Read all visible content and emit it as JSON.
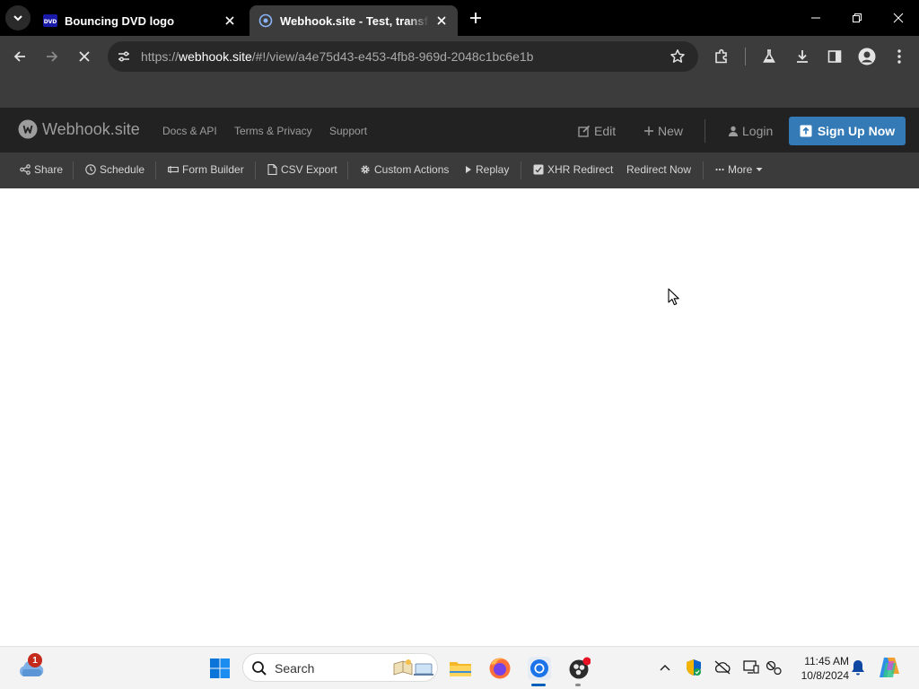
{
  "browser": {
    "tabs": [
      {
        "title": "Bouncing DVD logo",
        "active": false,
        "favicon": "dvd-icon"
      },
      {
        "title": "Webhook.site - Test, transform",
        "active": true,
        "favicon": "webhook-icon"
      }
    ],
    "url": {
      "prefix": "https://",
      "domain": "webhook.site",
      "path": "/#!/view/a4e75d43-e453-4fb8-969d-2048c1bc6e1b"
    },
    "loading": true
  },
  "site": {
    "brand": "Webhook.site",
    "nav_links": [
      "Docs & API",
      "Terms & Privacy",
      "Support"
    ],
    "edit_label": "Edit",
    "new_label": "New",
    "login_label": "Login",
    "signup_label": "Sign Up Now",
    "actions": {
      "share": "Share",
      "schedule": "Schedule",
      "form_builder": "Form Builder",
      "csv_export": "CSV Export",
      "custom_actions": "Custom Actions",
      "replay": "Replay",
      "xhr_redirect": "XHR Redirect",
      "redirect_now": "Redirect Now",
      "more": "More"
    }
  },
  "taskbar": {
    "weather_badge": "1",
    "search_placeholder": "Search",
    "time": "11:45 AM",
    "date": "10/8/2024"
  },
  "colors": {
    "signup_button": "#337ab7",
    "site_nav": "#222222",
    "actions_bar": "#3b3b3b",
    "browser_toolbar": "#3c3c3c"
  }
}
